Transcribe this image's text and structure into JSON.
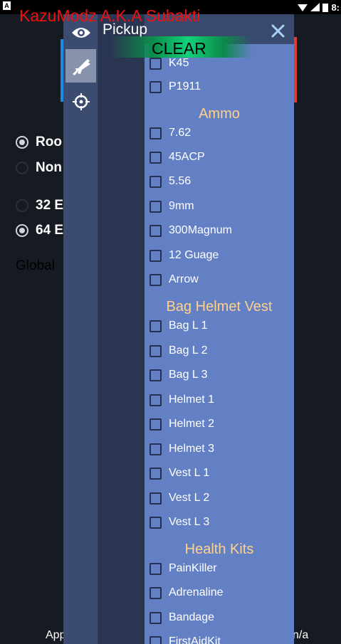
{
  "status_bar": {
    "time": "8:"
  },
  "watermark": "KazuModz A.K.A Subakti",
  "background": {
    "radios_a": [
      {
        "label": "Roo",
        "checked": true
      },
      {
        "label": "Non",
        "checked": false
      }
    ],
    "radios_b": [
      {
        "label": "32 E",
        "checked": false
      },
      {
        "label": "64 E",
        "checked": true
      }
    ],
    "global_label": "Global",
    "footer_left": "App",
    "footer_right": "n/a"
  },
  "menu": {
    "title": "Pickup",
    "clear_label": "CLEAR",
    "rail_icons": [
      "eye-icon",
      "rifle-icon",
      "crosshair-icon"
    ],
    "rows": [
      {
        "type": "item",
        "label": "K45",
        "partial": true
      },
      {
        "type": "item",
        "label": "P1911"
      },
      {
        "type": "section",
        "label": "Ammo"
      },
      {
        "type": "item",
        "label": "7.62"
      },
      {
        "type": "item",
        "label": "45ACP"
      },
      {
        "type": "item",
        "label": "5.56"
      },
      {
        "type": "item",
        "label": "9mm"
      },
      {
        "type": "item",
        "label": "300Magnum"
      },
      {
        "type": "item",
        "label": "12 Guage"
      },
      {
        "type": "item",
        "label": "Arrow"
      },
      {
        "type": "section",
        "label": "Bag Helmet Vest"
      },
      {
        "type": "item",
        "label": "Bag L 1"
      },
      {
        "type": "item",
        "label": "Bag L 2"
      },
      {
        "type": "item",
        "label": "Bag L 3"
      },
      {
        "type": "item",
        "label": "Helmet 1"
      },
      {
        "type": "item",
        "label": "Helmet 2"
      },
      {
        "type": "item",
        "label": "Helmet 3"
      },
      {
        "type": "item",
        "label": "Vest L 1"
      },
      {
        "type": "item",
        "label": "Vest L 2"
      },
      {
        "type": "item",
        "label": "Vest L 3"
      },
      {
        "type": "section",
        "label": "Health Kits"
      },
      {
        "type": "item",
        "label": "PainKiller"
      },
      {
        "type": "item",
        "label": "Adrenaline"
      },
      {
        "type": "item",
        "label": "Bandage"
      },
      {
        "type": "item",
        "label": "FirstAidKit"
      }
    ]
  },
  "colors": {
    "watermark": "#ee1111",
    "section_header": "#ffd28a",
    "list_bg": "#6480c5",
    "clear_bar": "#11d27a"
  }
}
